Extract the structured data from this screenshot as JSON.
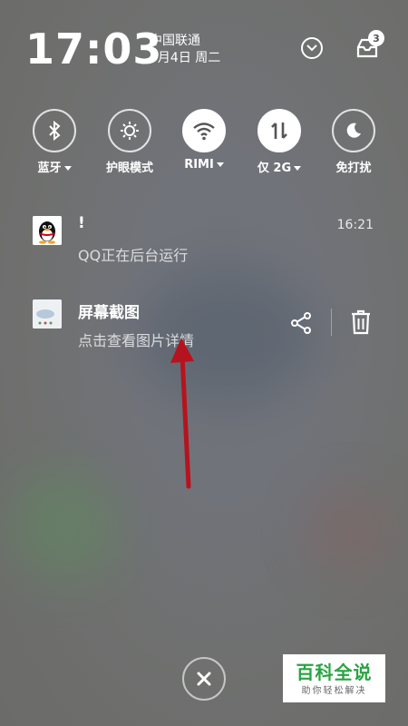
{
  "status": {
    "time": "17:03",
    "carrier": "中国联通",
    "date": "7月4日 周二",
    "notification_count": "3"
  },
  "quick_toggles": [
    {
      "label": "蓝牙",
      "icon": "bluetooth-icon",
      "active": false,
      "has_dropdown": true
    },
    {
      "label": "护眼模式",
      "icon": "eye-care-icon",
      "active": false,
      "has_dropdown": false
    },
    {
      "label": "RIMI",
      "icon": "wifi-icon",
      "active": true,
      "has_dropdown": true
    },
    {
      "label": "仅 2G",
      "icon": "mobile-data-icon",
      "active": true,
      "has_dropdown": true
    },
    {
      "label": "免打扰",
      "icon": "moon-icon",
      "active": false,
      "has_dropdown": false
    }
  ],
  "notifications": [
    {
      "app_icon": "qq-penguin-icon",
      "title": "!",
      "subtitle": "QQ正在后台运行",
      "time": "16:21"
    },
    {
      "app_icon": "screenshot-thumbnail",
      "title": "屏幕截图",
      "subtitle": "点击查看图片详情",
      "actions": [
        "share-icon",
        "trash-icon"
      ]
    }
  ],
  "annotation": {
    "color": "#b5141e",
    "icon": "red-arrow-annotation"
  },
  "watermark": {
    "main": "百科全说",
    "sub": "助你轻松解决",
    "color": "#2aa344"
  }
}
